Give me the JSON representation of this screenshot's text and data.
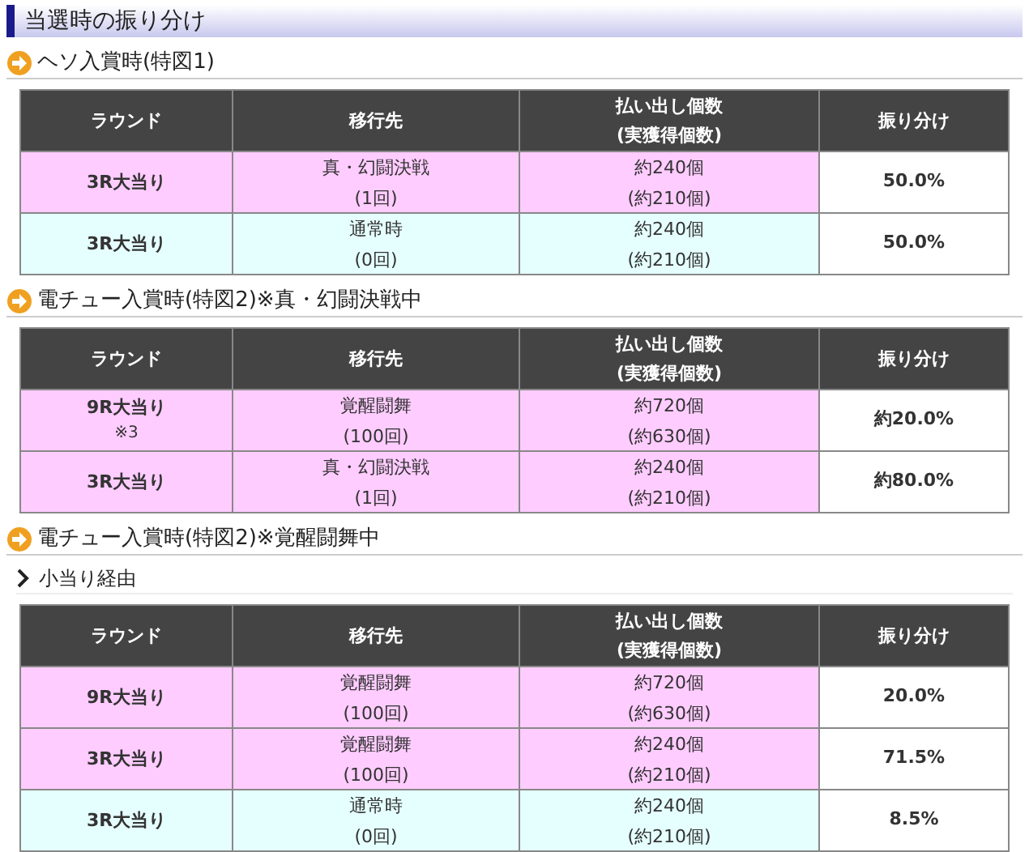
{
  "page_title": "当選時の振り分け",
  "sections": [
    {
      "heading": "ヘソ入賞時(特図1)",
      "table": {
        "columns": [
          [
            "ラウンド"
          ],
          [
            "移行先"
          ],
          [
            "払い出し個数",
            "(実獲得個数)"
          ],
          [
            "振り分け"
          ]
        ],
        "rows": [
          {
            "color": "#ffccff",
            "round": "3R大当り",
            "destination": [
              "真・幻闘決戦",
              "(1回)"
            ],
            "payout": [
              "約240個",
              "(約210個)"
            ],
            "share": "50.0%"
          },
          {
            "color": "#e5ffff",
            "round": "3R大当り",
            "destination": [
              "通常時",
              "(0回)"
            ],
            "payout": [
              "約240個",
              "(約210個)"
            ],
            "share": "50.0%"
          }
        ]
      }
    },
    {
      "heading": "電チュー入賞時(特図2)※真・幻闘決戦中",
      "table": {
        "columns": [
          [
            "ラウンド"
          ],
          [
            "移行先"
          ],
          [
            "払い出し個数",
            "(実獲得個数)"
          ],
          [
            "振り分け"
          ]
        ],
        "rows": [
          {
            "color": "#ffccff",
            "round": "9R大当り",
            "note": "※3",
            "destination": [
              "覚醒闘舞",
              "(100回)"
            ],
            "payout": [
              "約720個",
              "(約630個)"
            ],
            "share": "約20.0%"
          },
          {
            "color": "#ffccff",
            "round": "3R大当り",
            "destination": [
              "真・幻闘決戦",
              "(1回)"
            ],
            "payout": [
              "約240個",
              "(約210個)"
            ],
            "share": "約80.0%"
          }
        ]
      }
    },
    {
      "heading": "電チュー入賞時(特図2)※覚醒闘舞中",
      "subheading": "小当り経由",
      "table": {
        "columns": [
          [
            "ラウンド"
          ],
          [
            "移行先"
          ],
          [
            "払い出し個数",
            "(実獲得個数)"
          ],
          [
            "振り分け"
          ]
        ],
        "rows": [
          {
            "color": "#ffccff",
            "round": "9R大当り",
            "destination": [
              "覚醒闘舞",
              "(100回)"
            ],
            "payout": [
              "約720個",
              "(約630個)"
            ],
            "share": "20.0%"
          },
          {
            "color": "#ffccff",
            "round": "3R大当り",
            "destination": [
              "覚醒闘舞",
              "(100回)"
            ],
            "payout": [
              "約240個",
              "(約210個)"
            ],
            "share": "71.5%"
          },
          {
            "color": "#e5ffff",
            "round": "3R大当り",
            "destination": [
              "通常時",
              "(0回)"
            ],
            "payout": [
              "約240個",
              "(約210個)"
            ],
            "share": "8.5%"
          }
        ]
      }
    }
  ]
}
